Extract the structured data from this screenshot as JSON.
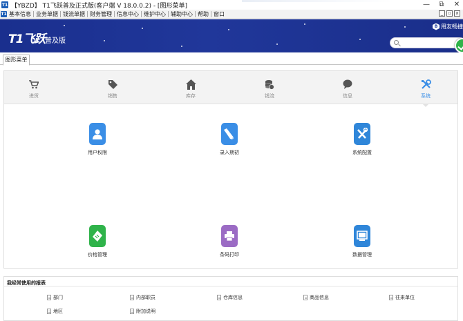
{
  "window": {
    "title": "【YBZD】 T1飞跃普及正式版(客户端 V 18.0.0.2) - [图形菜单]",
    "app_badge": "T1",
    "controls": [
      "—",
      "⧉",
      "✕"
    ]
  },
  "menubar": {
    "items": [
      "基本信息",
      "业务单据",
      "钱流单据",
      "财务管理",
      "信息中心",
      "维护中心",
      "辅助中心",
      "帮助",
      "窗口"
    ],
    "mdi_controls": [
      "_",
      "▫",
      "x"
    ]
  },
  "banner": {
    "logo_text": "T1飞跃",
    "logo_sub": "普及版",
    "brand_text": "用友畅捷",
    "brand_badge": "B",
    "search_placeholder": ""
  },
  "tabs": [
    {
      "label": "图形菜单"
    }
  ],
  "categories": [
    {
      "label": "进货",
      "icon": "cart-icon"
    },
    {
      "label": "销售",
      "icon": "tag-icon"
    },
    {
      "label": "库存",
      "icon": "home-icon"
    },
    {
      "label": "钱流",
      "icon": "coins-icon"
    },
    {
      "label": "信息",
      "icon": "chat-bubble-icon"
    },
    {
      "label": "系统",
      "icon": "tools-icon",
      "active": true
    }
  ],
  "functions": [
    {
      "label": "用户权限",
      "icon": "user-icon",
      "color": "#3a8ee6"
    },
    {
      "label": "录入期初",
      "icon": "pencil-icon",
      "color": "#3a8ee6"
    },
    {
      "label": "系统配置",
      "icon": "wrench-icon",
      "color": "#2f86d9"
    },
    {
      "label": "价格管理",
      "icon": "price-tag-icon",
      "color": "#2fb34a"
    },
    {
      "label": "条码打印",
      "icon": "printer-icon",
      "color": "#9b6bc4"
    },
    {
      "label": "数据管理",
      "icon": "monitor-icon",
      "color": "#2f86d9"
    }
  ],
  "reports": {
    "title": "我经常使用的报表",
    "items": [
      "部门",
      "内部职员",
      "仓库信息",
      "商品信息",
      "往来单位",
      "地区",
      "附加说明"
    ]
  }
}
